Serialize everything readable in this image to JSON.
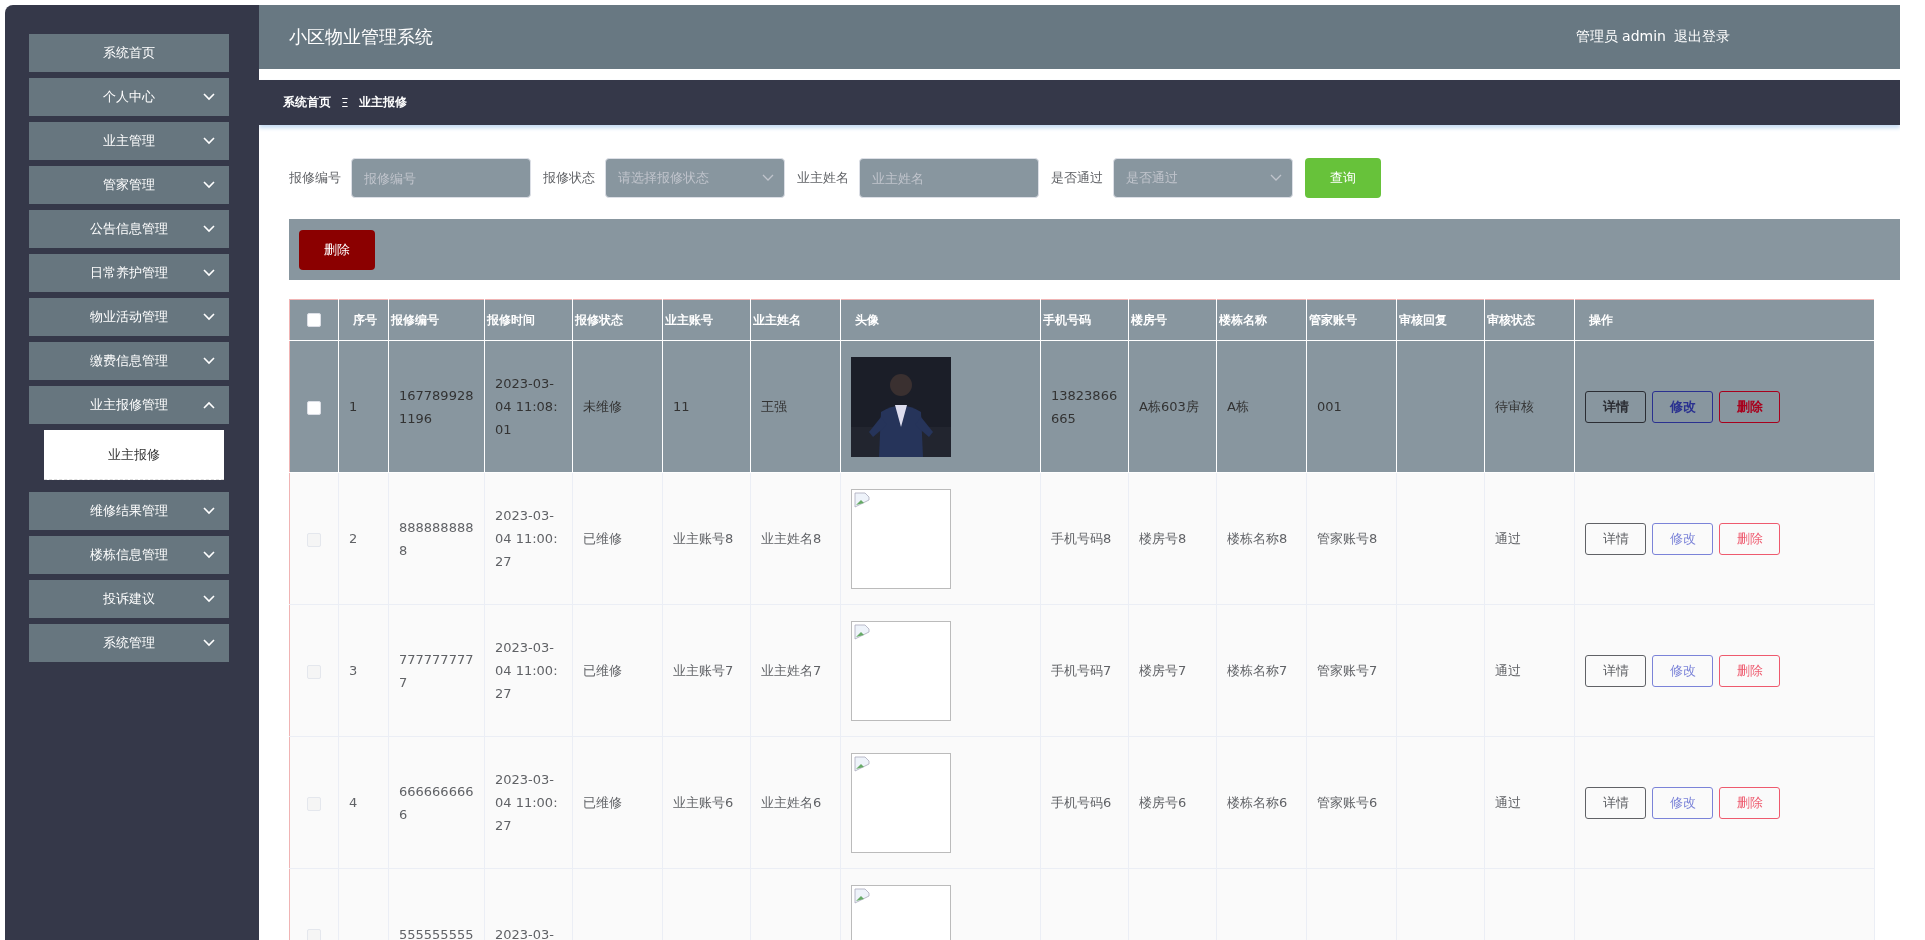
{
  "sidebar": {
    "items": [
      {
        "kind": "link",
        "label": "系统首页"
      },
      {
        "kind": "menu",
        "label": "个人中心",
        "expanded": false
      },
      {
        "kind": "menu",
        "label": "业主管理",
        "expanded": false
      },
      {
        "kind": "menu",
        "label": "管家管理",
        "expanded": false
      },
      {
        "kind": "menu",
        "label": "公告信息管理",
        "expanded": false
      },
      {
        "kind": "menu",
        "label": "日常养护管理",
        "expanded": false
      },
      {
        "kind": "menu",
        "label": "物业活动管理",
        "expanded": false
      },
      {
        "kind": "menu",
        "label": "缴费信息管理",
        "expanded": false
      },
      {
        "kind": "menu",
        "label": "业主报修管理",
        "expanded": true,
        "children": [
          {
            "label": "业主报修",
            "selected": true
          }
        ]
      },
      {
        "kind": "menu",
        "label": "维修结果管理",
        "expanded": false
      },
      {
        "kind": "menu",
        "label": "楼栋信息管理",
        "expanded": false
      },
      {
        "kind": "menu",
        "label": "投诉建议",
        "expanded": false
      },
      {
        "kind": "menu",
        "label": "系统管理",
        "expanded": false
      }
    ]
  },
  "header": {
    "title": "小区物业管理系统",
    "user": "管理员 admin",
    "logout": "退出登录"
  },
  "breadcrumb": {
    "items": [
      "系统首页",
      "业主报修"
    ],
    "separator": "Ξ"
  },
  "filters": [
    {
      "kind": "input",
      "label": "报修编号",
      "placeholder": "报修编号"
    },
    {
      "kind": "select",
      "label": "报修状态",
      "placeholder": "请选择报修状态"
    },
    {
      "kind": "input",
      "label": "业主姓名",
      "placeholder": "业主姓名"
    },
    {
      "kind": "select",
      "label": "是否通过",
      "placeholder": "是否通过"
    }
  ],
  "search_button": "查询",
  "toolbar": {
    "delete_button": "删除"
  },
  "table": {
    "select_all_checked": false,
    "columns": [
      "序号",
      "报修编号",
      "报修时间",
      "报修状态",
      "业主账号",
      "业主姓名",
      "头像",
      "手机号码",
      "楼房号",
      "楼栋名称",
      "管家账号",
      "审核回复",
      "审核状态",
      "操作"
    ],
    "rows": [
      {
        "hovered": true,
        "checked": false,
        "index": "1",
        "code": "1677899281196",
        "time": "2023-03-04 11:08:01",
        "repair_status": "未维修",
        "account": "11",
        "name": "王强",
        "avatar": {
          "kind": "picture"
        },
        "phone": "13823866665",
        "room": "A栋603房",
        "building": "A栋",
        "manager": "001",
        "audit": "待审核",
        "actions": [
          "详情",
          "修改",
          "删除"
        ]
      },
      {
        "hovered": false,
        "checked": false,
        "index": "2",
        "code": "8888888888",
        "time": "2023-03-04 11:00:27",
        "repair_status": "已维修",
        "account": "业主账号8",
        "name": "业主姓名8",
        "avatar": {
          "kind": "broken_image"
        },
        "phone": "手机号码8",
        "room": "楼房号8",
        "building": "楼栋名称8",
        "manager": "管家账号8",
        "audit": "通过",
        "actions": [
          "详情",
          "修改",
          "删除"
        ]
      },
      {
        "hovered": false,
        "checked": false,
        "index": "3",
        "code": "7777777777",
        "time": "2023-03-04 11:00:27",
        "repair_status": "已维修",
        "account": "业主账号7",
        "name": "业主姓名7",
        "avatar": {
          "kind": "broken_image"
        },
        "phone": "手机号码7",
        "room": "楼房号7",
        "building": "楼栋名称7",
        "manager": "管家账号7",
        "audit": "通过",
        "actions": [
          "详情",
          "修改",
          "删除"
        ]
      },
      {
        "hovered": false,
        "checked": false,
        "index": "4",
        "code": "6666666666",
        "time": "2023-03-04 11:00:27",
        "repair_status": "已维修",
        "account": "业主账号6",
        "name": "业主姓名6",
        "avatar": {
          "kind": "broken_image"
        },
        "phone": "手机号码6",
        "room": "楼房号6",
        "building": "楼栋名称6",
        "manager": "管家账号6",
        "audit": "通过",
        "actions": [
          "详情",
          "修改",
          "删除"
        ]
      },
      {
        "hovered": false,
        "checked": false,
        "code": "555555555",
        "time": "2023-03-",
        "avatar": {
          "kind": "broken_image"
        }
      }
    ]
  }
}
